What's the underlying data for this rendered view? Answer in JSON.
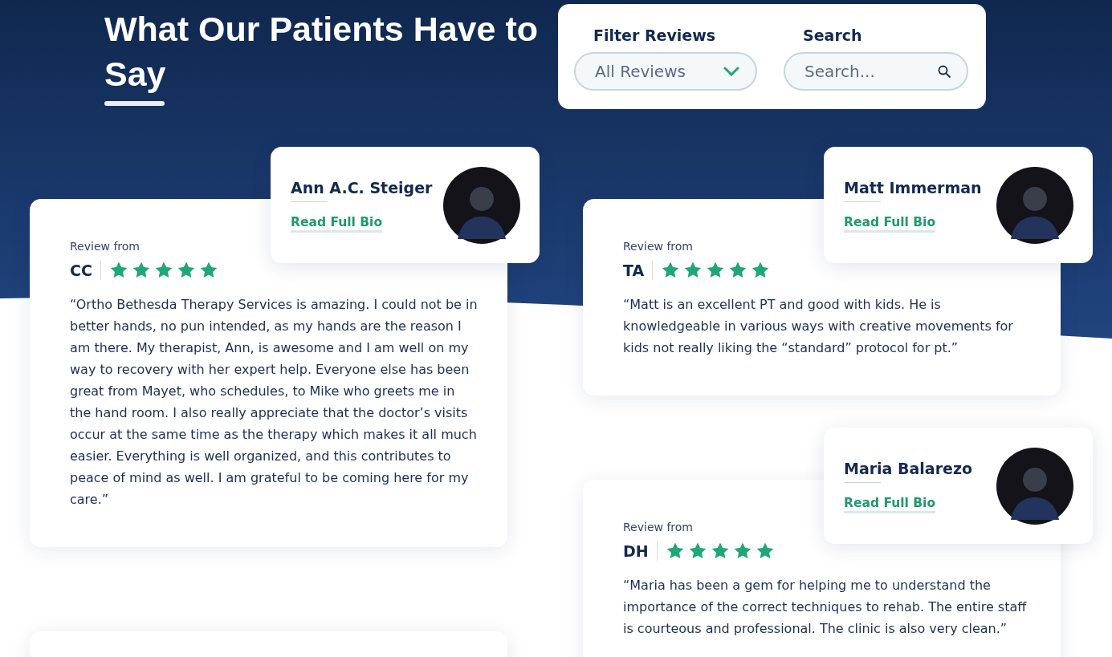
{
  "header": {
    "title": "What Our Patients Have to Say"
  },
  "filters": {
    "filter_label": "Filter Reviews",
    "filter_value": "All Reviews",
    "search_label": "Search",
    "search_placeholder": "Search..."
  },
  "columns": [
    {
      "reviews": [
        {
          "kind": "full",
          "therapist": "Ann A.C. Steiger",
          "bio_link": "Read Full Bio",
          "label": "Review from",
          "reviewer": "CC",
          "stars": 5,
          "text": "“Ortho Bethesda Therapy Services is amazing. I could not be in better hands, no pun intended, as my hands are the reason I am there. My therapist, Ann, is awesome and I am well on my way to recovery with her expert help. Everyone else has been great from Mayet, who schedules, to Mike who greets me in the hand room. I also really appreciate that the doctor’s visits occur at the same time as the therapy which makes it all much easier. Everything is well organized, and this contributes to peace of mind as well. I am grateful to be coming here for my care.”"
        },
        {
          "kind": "cut-off"
        }
      ]
    },
    {
      "reviews": [
        {
          "kind": "full",
          "therapist": "Matt Immerman",
          "bio_link": "Read Full Bio",
          "label": "Review from",
          "reviewer": "TA",
          "stars": 5,
          "text": "“Matt is an excellent PT and good with kids. He is knowledgeable in various ways with creative movements for kids not really liking the “standard” protocol for pt.”"
        },
        {
          "kind": "full",
          "therapist": "Maria Balarezo",
          "bio_link": "Read Full Bio",
          "label": "Review from",
          "reviewer": "DH",
          "stars": 5,
          "text": "“Maria has been a gem for helping me to understand the importance of the correct techniques to rehab. The entire staff is courteous and professional. The clinic is also very clean.”"
        }
      ]
    }
  ]
}
